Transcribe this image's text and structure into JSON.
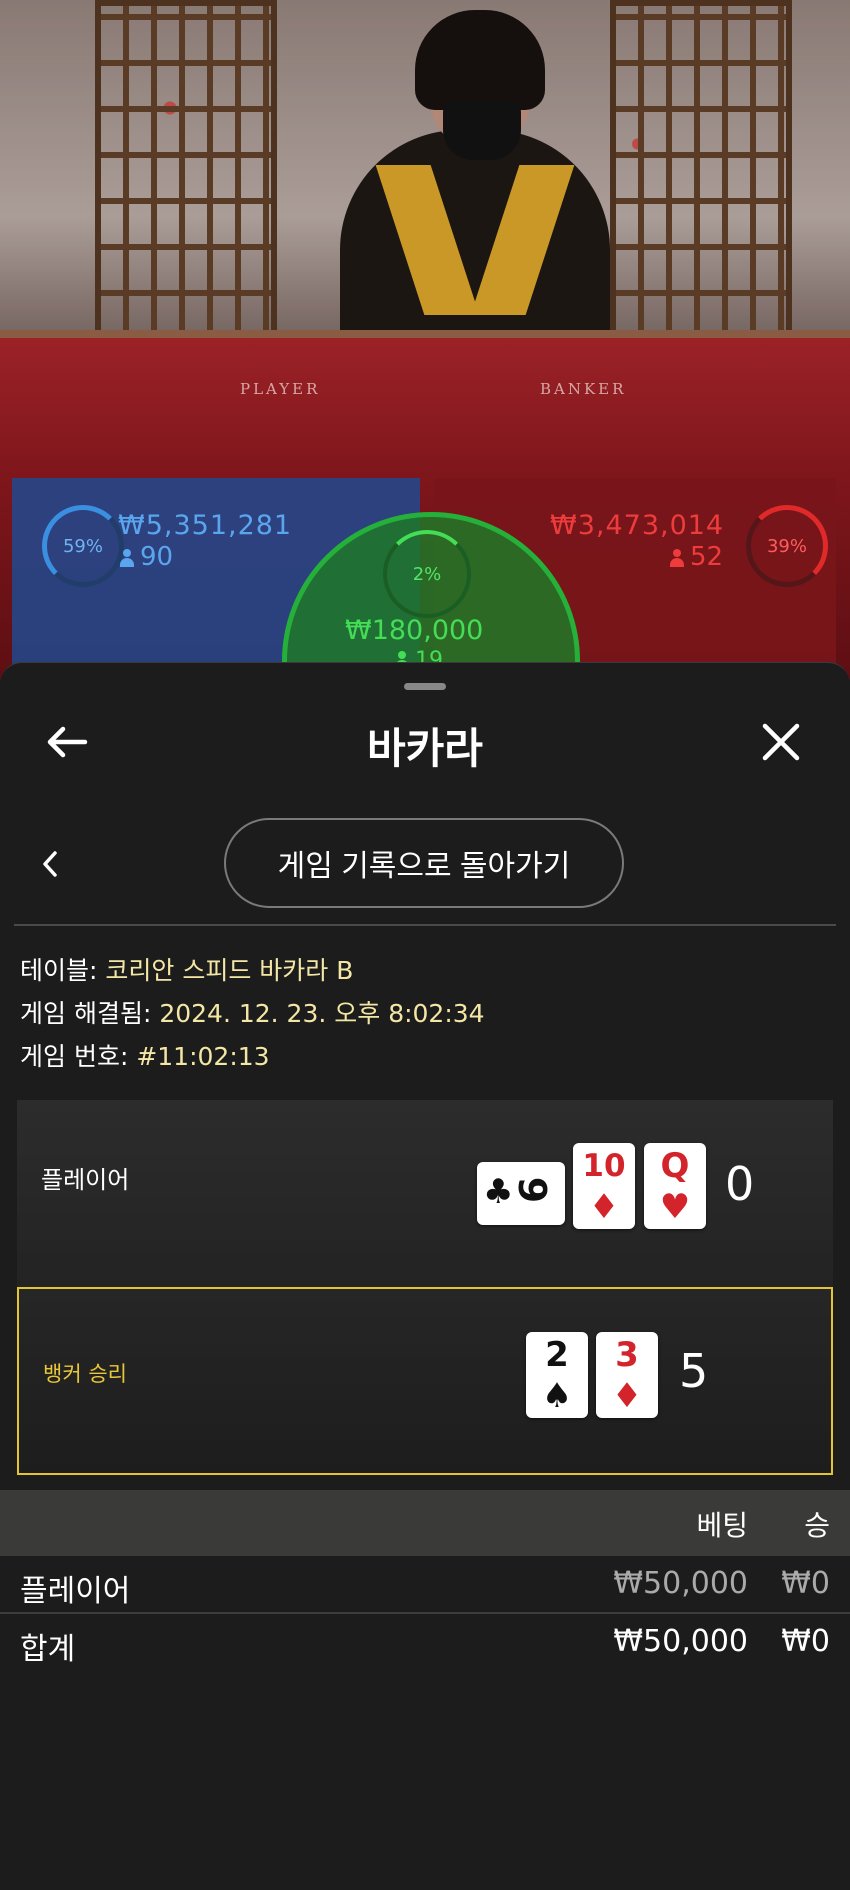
{
  "stream": {
    "table_labels": {
      "player": "PLAYER",
      "banker": "BANKER"
    },
    "player_stats": {
      "percent": "59%",
      "amount": "₩5,351,281",
      "count": "90"
    },
    "banker_stats": {
      "percent": "39%",
      "amount": "₩3,473,014",
      "count": "52"
    },
    "tie_stats": {
      "percent": "2%",
      "amount": "₩180,000",
      "count": "19"
    }
  },
  "header": {
    "title": "바카라",
    "back_icon": "arrow-left-icon",
    "close_icon": "close-icon"
  },
  "subnav": {
    "chevron_icon": "chevron-left-icon",
    "back_to_history_label": "게임 기록으로 돌아가기"
  },
  "info": {
    "table_label": "테이블:",
    "table_value": "코리안 스피드 바카라 B",
    "resolved_label": "게임 해결됨:",
    "resolved_value": "2024. 12. 23. 오후 8:02:34",
    "number_label": "게임 번호:",
    "number_value": "#11:02:13"
  },
  "hands": {
    "player": {
      "label": "플레이어",
      "cards": [
        {
          "rank": "9",
          "suit": "♣",
          "color": "black",
          "orientation": "sideways"
        },
        {
          "rank": "10",
          "suit": "♦",
          "color": "red"
        },
        {
          "rank": "Q",
          "suit": "♥",
          "color": "red"
        }
      ],
      "total": "0"
    },
    "banker": {
      "label": "뱅커 승리",
      "cards": [
        {
          "rank": "2",
          "suit": "♠",
          "color": "black"
        },
        {
          "rank": "3",
          "suit": "♦",
          "color": "red"
        }
      ],
      "total": "5"
    }
  },
  "bets_table": {
    "headers": {
      "bet": "베팅",
      "win": "승"
    },
    "rows": [
      {
        "name": "플레이어",
        "bet": "₩50,000",
        "win": "₩0"
      }
    ],
    "total": {
      "name": "합계",
      "bet": "₩50,000",
      "win": "₩0"
    }
  },
  "colors": {
    "sheet_bg": "#1c1c1c",
    "info_value": "#f4e7a6",
    "banker_win_accent": "#e3c531",
    "player_blue": "#3a8fe0",
    "banker_red": "#e02a2a",
    "tie_green": "#44dd55"
  }
}
